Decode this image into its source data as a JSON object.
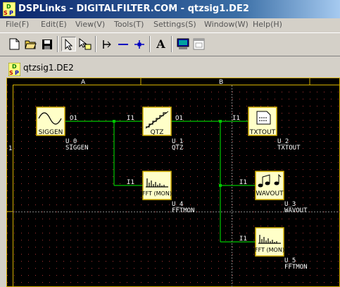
{
  "window": {
    "title": "DSPLinks - DIGITALFILTER.COM - qtzsig1.DE2",
    "app_icon": "dsp-app-icon"
  },
  "menu": [
    "File(F)",
    "Edit(E)",
    "View(V)",
    "Tools(T)",
    "Settings(S)",
    "Window(W)",
    "Help(H)"
  ],
  "toolbar": [
    {
      "name": "new-file-icon"
    },
    {
      "name": "open-folder-icon"
    },
    {
      "name": "save-icon"
    },
    {
      "name": "select-pointer-icon"
    },
    {
      "name": "move-pointer-icon"
    },
    {
      "name": "wire-tool-icon"
    },
    {
      "name": "line-tool-icon"
    },
    {
      "name": "junction-tool-icon"
    },
    {
      "name": "text-tool-icon",
      "label": "A"
    },
    {
      "name": "monitor-icon"
    },
    {
      "name": "window-icon"
    }
  ],
  "document": {
    "title": "qtzsig1.DE2"
  },
  "grid": {
    "col_labels": [
      "A",
      "B"
    ],
    "row_labels": [
      "1"
    ]
  },
  "blocks": [
    {
      "id": "U_0",
      "type": "SIGGEN",
      "display": "SIGGEN",
      "out": "O1",
      "in": ""
    },
    {
      "id": "U_1",
      "type": "QTZ",
      "display": "QTZ",
      "out": "O1",
      "in": "I1"
    },
    {
      "id": "U_2",
      "type": "TXTOUT",
      "display": "TXTOUT",
      "out": "",
      "in": "I1"
    },
    {
      "id": "U_4",
      "type": "FFTMON",
      "display": "FFT (MON)",
      "out": "",
      "in": "I1"
    },
    {
      "id": "U_3",
      "type": "WAVOUT",
      "display": "WAVOUT",
      "out": "",
      "in": "I1"
    },
    {
      "id": "U_5",
      "type": "FFTMON",
      "display": "FFT (MON)",
      "out": "",
      "in": "I1"
    }
  ],
  "colors": {
    "canvas_bg": "#000000",
    "block_fill": "#ffffc8",
    "block_stroke": "#d4af00",
    "wire": "#00c800",
    "label": "#ffffff",
    "accent": "#0a246a"
  }
}
